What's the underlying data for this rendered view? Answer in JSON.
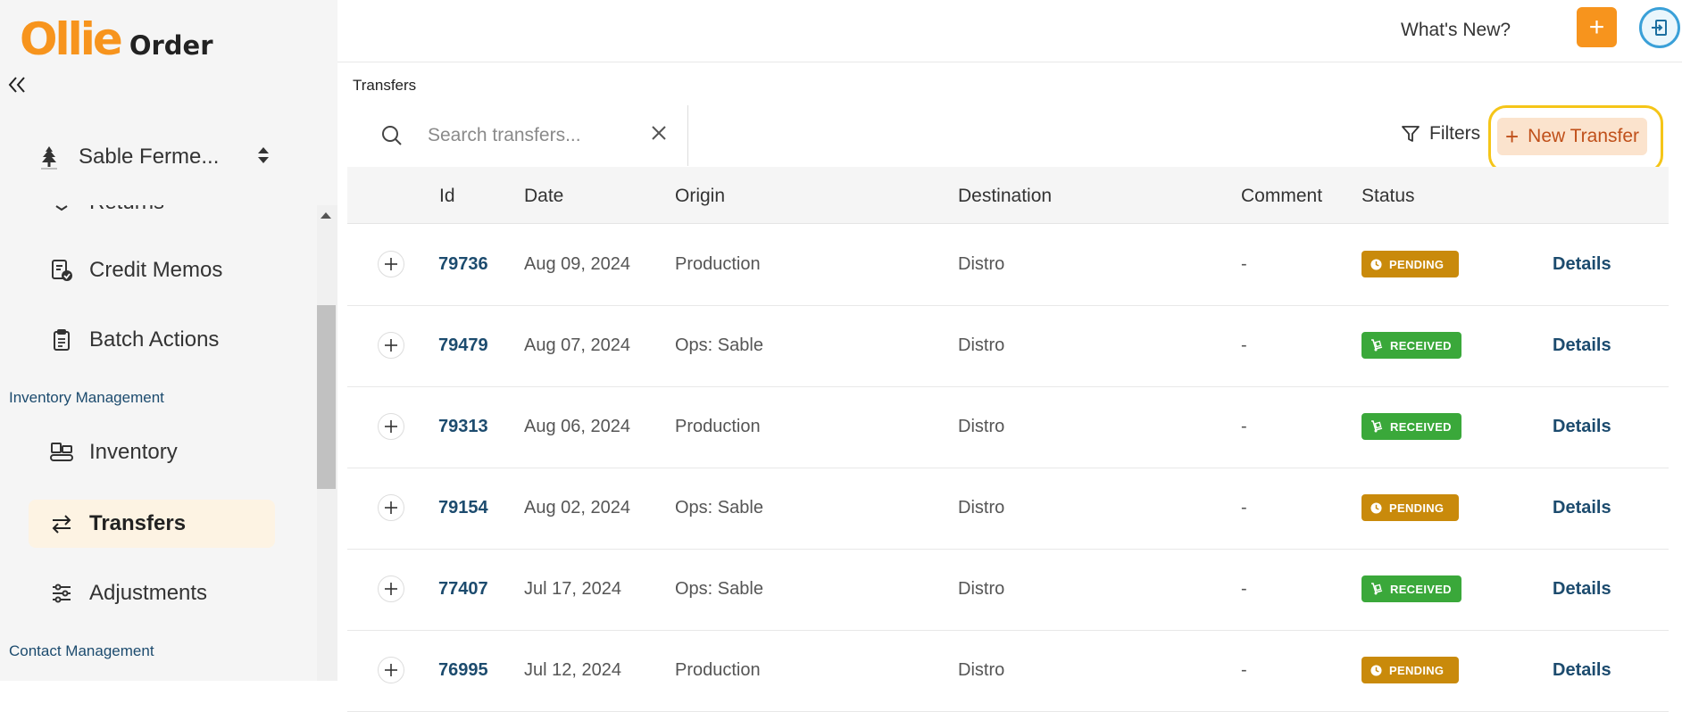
{
  "brand": {
    "mark": "Ollie",
    "word": "Order",
    "accent": "#f7941d"
  },
  "account": {
    "name": "Sable Ferme..."
  },
  "sidebar": {
    "items": [
      {
        "label": "Returns"
      },
      {
        "label": "Credit Memos"
      },
      {
        "label": "Batch Actions"
      },
      {
        "label": "Inventory"
      },
      {
        "label": "Transfers"
      },
      {
        "label": "Adjustments"
      }
    ],
    "sections": {
      "inventory": "Inventory Management",
      "contact": "Contact Management"
    }
  },
  "topbar": {
    "whats_new": "What's New?",
    "add_label": "+"
  },
  "breadcrumb": "Transfers",
  "search": {
    "placeholder": "Search transfers..."
  },
  "toolbar": {
    "filters_label": "Filters",
    "new_transfer_label": "New Transfer"
  },
  "table": {
    "columns": {
      "id": "Id",
      "date": "Date",
      "origin": "Origin",
      "destination": "Destination",
      "comment": "Comment",
      "status": "Status"
    },
    "rows": [
      {
        "id": "79736",
        "date": "Aug 09, 2024",
        "origin": "Production",
        "destination": "Distro",
        "comment": "-",
        "status": "PENDING",
        "action": "Details"
      },
      {
        "id": "79479",
        "date": "Aug 07, 2024",
        "origin": "Ops: Sable",
        "destination": "Distro",
        "comment": "-",
        "status": "RECEIVED",
        "action": "Details"
      },
      {
        "id": "79313",
        "date": "Aug 06, 2024",
        "origin": "Production",
        "destination": "Distro",
        "comment": "-",
        "status": "RECEIVED",
        "action": "Details"
      },
      {
        "id": "79154",
        "date": "Aug 02, 2024",
        "origin": "Ops: Sable",
        "destination": "Distro",
        "comment": "-",
        "status": "PENDING",
        "action": "Details"
      },
      {
        "id": "77407",
        "date": "Jul 17, 2024",
        "origin": "Ops: Sable",
        "destination": "Distro",
        "comment": "-",
        "status": "RECEIVED",
        "action": "Details"
      },
      {
        "id": "76995",
        "date": "Jul 12, 2024",
        "origin": "Production",
        "destination": "Distro",
        "comment": "-",
        "status": "PENDING",
        "action": "Details"
      }
    ]
  },
  "colors": {
    "pending": "#c98a0b",
    "received": "#3aa83a",
    "link": "#1c4b6e",
    "highlight": "#f5c518"
  }
}
